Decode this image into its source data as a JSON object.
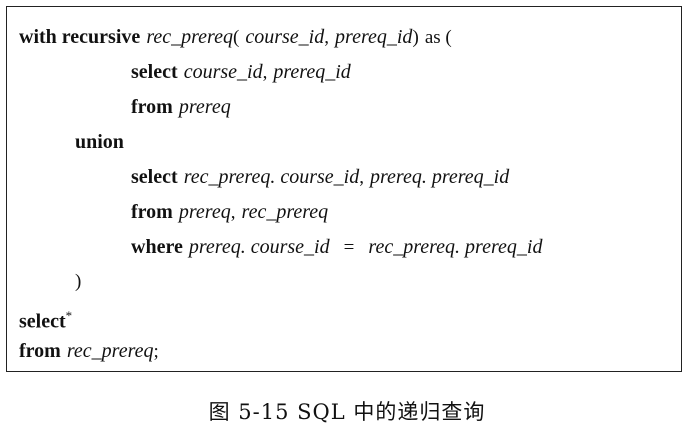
{
  "code": {
    "line1": {
      "kw": "with recursive",
      "name": "rec_prereq",
      "open": "(",
      "arg1": "course_id",
      "sep": ",",
      "arg2": "prereq_id",
      "close": ")",
      "as": "as ("
    },
    "line2": {
      "kw": "select",
      "a": "course_id",
      "sep": ",",
      "b": "prereq_id"
    },
    "line3": {
      "kw": "from",
      "a": "prereq"
    },
    "line4": {
      "kw": "union"
    },
    "line5": {
      "kw": "select",
      "a": "rec_prereq. course_id",
      "sep": ",",
      "b": "prereq. prereq_id"
    },
    "line6": {
      "kw": "from",
      "a": "prereq",
      "sep": ",",
      "b": "rec_prereq"
    },
    "line7": {
      "kw": "where",
      "a": "prereq. course_id",
      "op": "=",
      "b": "rec_prereq. prereq_id"
    },
    "line8": {
      "close": ")"
    },
    "line9": {
      "kw": "select",
      "star": "*"
    },
    "line10": {
      "kw": "from",
      "a": "rec_prereq",
      "end": ";"
    }
  },
  "caption": "图 5-15   SQL 中的递归查询"
}
